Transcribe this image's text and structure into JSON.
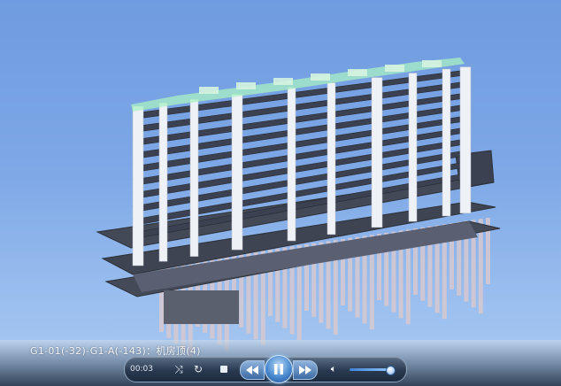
{
  "player": {
    "caption": "G1-01(-32)-G1-A(-143)：机房顶(4)",
    "time": "00:03",
    "volume_fraction": 0.88,
    "controls": {
      "shuffle_icon": "shuffle-icon",
      "repeat_icon": "repeat-icon",
      "stop_icon": "stop-icon",
      "prev_icon": "rewind-icon",
      "play_icon": "pause-icon",
      "next_icon": "fast-forward-icon",
      "volume_icon": "speaker-icon"
    }
  },
  "colors": {
    "sky_top": "#6f9be0",
    "sky_bottom": "#a9c9f0",
    "column": "#eef1f6",
    "slab": "#3b4150",
    "roof_tint": "#a8f0c4"
  }
}
